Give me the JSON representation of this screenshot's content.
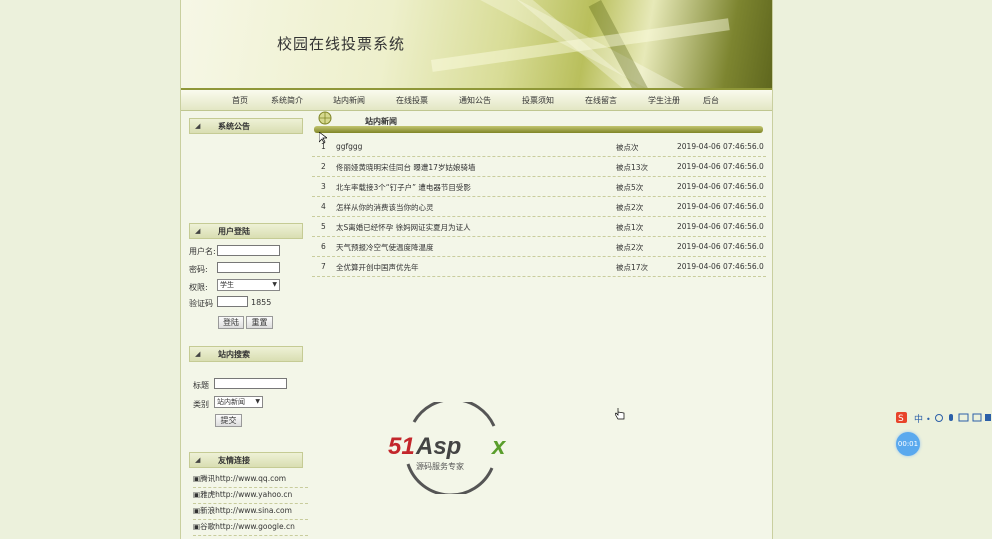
{
  "header": {
    "title": "校园在线投票系统"
  },
  "nav": {
    "items": [
      "首页",
      "系统简介",
      "站内新闻",
      "在线投票",
      "通知公告",
      "投票须知",
      "在线留言",
      "学生注册",
      "后台"
    ]
  },
  "sidebar": {
    "announce_title": "系统公告",
    "login_title": "用户登陆",
    "username_label": "用户名:",
    "password_label": "密码:",
    "role_label": "权限:",
    "role_value": "学生",
    "captcha_label": "验证码",
    "captcha_code": "1855",
    "login_button": "登陆",
    "reset_button": "重置",
    "search_title": "站内搜索",
    "search_title_label": "标题",
    "search_cat_label": "类别",
    "search_cat_value": "站内新闻",
    "search_button": "提交",
    "links_title": "友情连接",
    "links": [
      "腾讯http://www.qq.com",
      "雅虎http://www.yahoo.cn",
      "新浪http://www.sina.com",
      "谷歌http://www.google.cn"
    ]
  },
  "main": {
    "section_title": "站内新闻",
    "news": [
      {
        "no": "1",
        "title": "ggfggg",
        "clicks": "被点次",
        "date": "2019-04-06 07:46:56.0"
      },
      {
        "no": "2",
        "title": "佟丽娅黄晓明宋佳同台 曝遭17岁姑娘骑墙",
        "clicks": "被点13次",
        "date": "2019-04-06 07:46:56.0"
      },
      {
        "no": "3",
        "title": "北车率载接3个“钉子户” 遭电器节目受影",
        "clicks": "被点5次",
        "date": "2019-04-06 07:46:56.0"
      },
      {
        "no": "4",
        "title": "怎样从你的消费该当你的心灵",
        "clicks": "被点2次",
        "date": "2019-04-06 07:46:56.0"
      },
      {
        "no": "5",
        "title": "太S离婚已经怀孕 徐妈网证实夏月为证人",
        "clicks": "被点1次",
        "date": "2019-04-06 07:46:56.0"
      },
      {
        "no": "6",
        "title": "天气预报冷空气使温度降温度",
        "clicks": "被点2次",
        "date": "2019-04-06 07:46:56.0"
      },
      {
        "no": "7",
        "title": "全优算开创中国声优先年",
        "clicks": "被点17次",
        "date": "2019-04-06 07:46:56.0"
      }
    ]
  },
  "watermark": {
    "brand": "51Aspx",
    "tagline": "源码服务专家"
  },
  "overlay": {
    "ime_text": "中",
    "timer": "00:01"
  },
  "colors": {
    "accent": "#8f9738",
    "background": "#ecf1dc",
    "brand_red": "#c3262b",
    "brand_green": "#5a9e2c"
  }
}
